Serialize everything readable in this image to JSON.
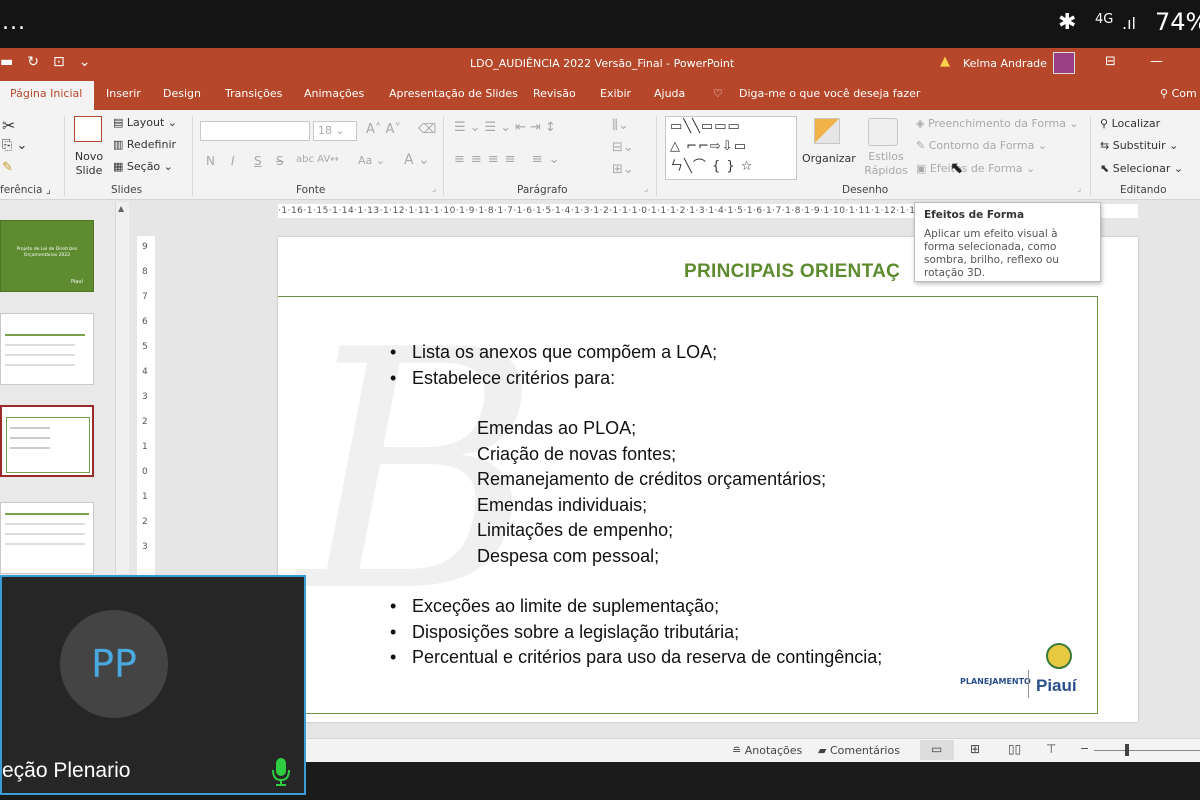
{
  "status_bar": {
    "dots": "...",
    "network": "4G",
    "battery": "74%"
  },
  "window": {
    "title": "LDO_AUDIÊNCIA 2022 Versão_Final  -  PowerPoint",
    "user": "Kelma Andrade"
  },
  "tabs": [
    "Página Inicial",
    "Inserir",
    "Design",
    "Transições",
    "Animações",
    "Apresentação de Slides",
    "Revisão",
    "Exibir",
    "Ajuda"
  ],
  "tell_me": "Diga-me o que você deseja fazer",
  "share_label": "Com",
  "ribbon": {
    "clipboard_label": "ferência",
    "slides": {
      "new_slide": "Novo Slide",
      "layout": "Layout",
      "reset": "Redefinir",
      "section": "Seção",
      "label": "Slides"
    },
    "font": {
      "size": "18",
      "bold": "N",
      "italic": "I",
      "underline": "S",
      "strike": "S",
      "label": "Fonte",
      "case": "Aa"
    },
    "paragraph_label": "Parágrafo",
    "drawing": {
      "arrange": "Organizar",
      "quick_styles": "Estilos Rápidos",
      "fill": "Preenchimento da Forma",
      "outline": "Contorno da Forma",
      "effects": "Efeitos de Forma",
      "label": "Desenho"
    },
    "editing": {
      "find": "Localizar",
      "replace": "Substituir",
      "select": "Selecionar",
      "label": "Editando"
    }
  },
  "tooltip": {
    "title": "Efeitos de Forma",
    "body": "Aplicar um efeito visual à forma selecionada, como sombra, brilho, reflexo ou rotação 3D."
  },
  "ruler": "·1·16·1·15·1·14·1·13·1·12·1·11·1·10·1·9·1·8·1·7·1·6·1·5·1·4·1·3·1·2·1·1·1·0·1·1·1·2·1·3·1·4·1·5·1·6·1·7·1·8·1·9·1·10·1·11·1·12·1·13·1·14·1·15·1·16·",
  "slide": {
    "title": "PRINCIPAIS ORIENTAÇ",
    "bullets_top": [
      "Lista os anexos que compõem a LOA;",
      "Estabelece critérios para:"
    ],
    "sub_items": [
      "Emendas ao PLOA;",
      "Criação de novas fontes;",
      "Remanejamento de créditos orçamentários;",
      "Emendas individuais;",
      "Limitações de empenho;",
      "Despesa com pessoal;"
    ],
    "bullets_bottom": [
      "Exceções ao limite de suplementação;",
      "Disposições sobre a legislação tributária;",
      "Percentual e critérios para uso da reserva de contingência;"
    ],
    "logo_text": "PLANEJAMENTO",
    "logo_brand": "Piauí"
  },
  "thumbnails": [
    {
      "title": "Projeto de Lei de Diretrizes Orçamentárias 2022",
      "brand": "Piauí"
    }
  ],
  "status": {
    "notes": "Anotações",
    "comments": "Comentários"
  },
  "video": {
    "initials": "PP",
    "name": "eção Plenario"
  },
  "colors": {
    "accent": "#b7472a",
    "slide_green": "#5e8b2f",
    "tile_border": "#3a9dd6",
    "mic": "#2ecc40"
  }
}
